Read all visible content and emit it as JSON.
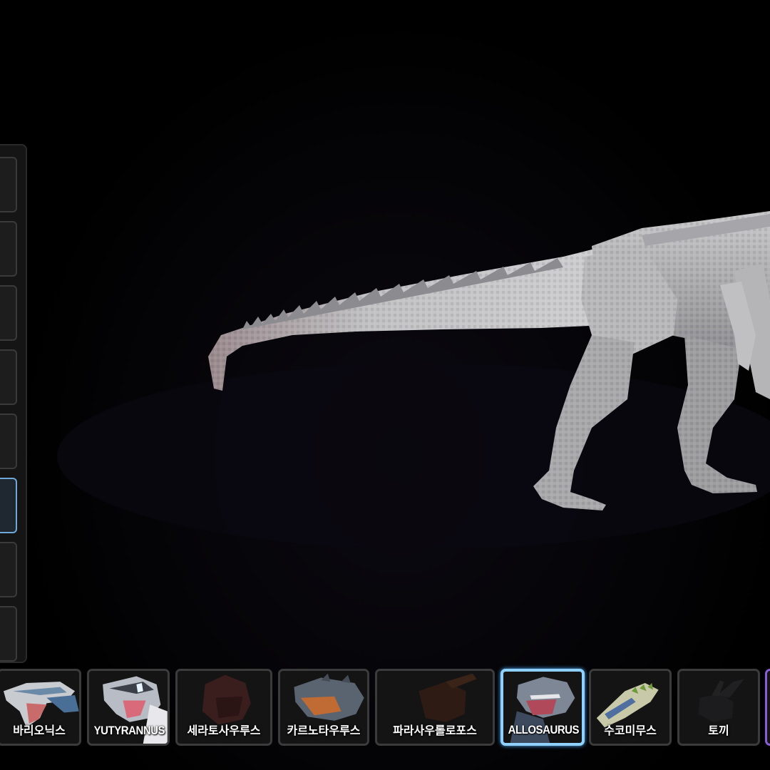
{
  "scene": {
    "creature_name": "ALLOSAURUS"
  },
  "side_panel": {
    "slots": [
      {
        "active": false
      },
      {
        "active": false
      },
      {
        "active": false
      },
      {
        "active": false
      },
      {
        "active": false
      },
      {
        "active": true
      },
      {
        "active": false
      },
      {
        "active": false
      }
    ]
  },
  "character_bar": {
    "cards": [
      {
        "label": "바리오닉스",
        "icon": "baryonyx-portrait-icon"
      },
      {
        "label": "YUTYRANNUS",
        "icon": "yutyrannus-portrait-icon"
      },
      {
        "label": "세라토사우루스",
        "icon": "ceratosaurus-portrait-icon"
      },
      {
        "label": "카르노타우루스",
        "icon": "carnotaurus-portrait-icon"
      },
      {
        "label": "파라사우롤로포스",
        "icon": "parasaurolophus-portrait-icon"
      },
      {
        "label": "ALLOSAURUS",
        "icon": "allosaurus-portrait-icon",
        "selected": true
      },
      {
        "label": "수코미무스",
        "icon": "suchomimus-portrait-icon"
      },
      {
        "label": "토끼",
        "icon": "rabbit-portrait-icon"
      }
    ]
  },
  "colors": {
    "selected_border": "#8fd0ff",
    "active_slot_border": "#6fa8d8",
    "partial_card_border": "#8a5cd6"
  }
}
